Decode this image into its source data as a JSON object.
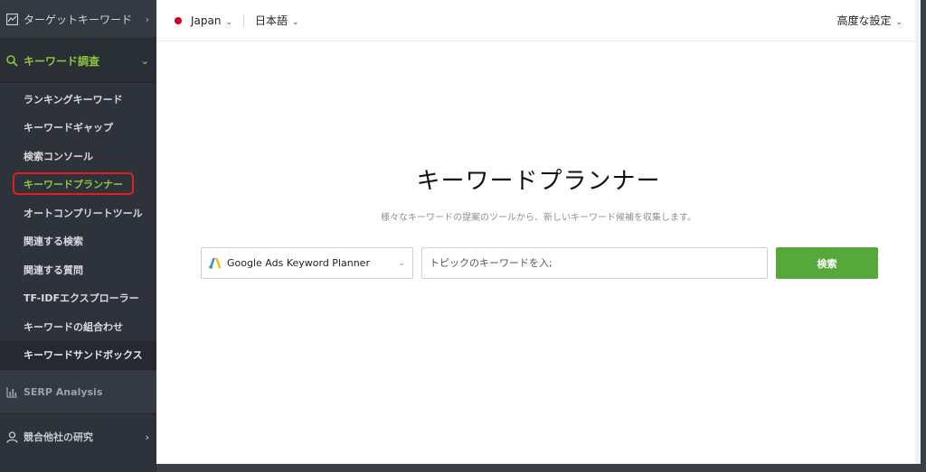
{
  "sidebar": {
    "top_item": "ターゲットキーワード",
    "section": "キーワード調査",
    "items": [
      {
        "label": "ランキングキーワード",
        "state": ""
      },
      {
        "label": "キーワードギャップ",
        "state": ""
      },
      {
        "label": "検索コンソール",
        "state": ""
      },
      {
        "label": "キーワードプランナー",
        "state": "active"
      },
      {
        "label": "オートコンプリートツール",
        "state": ""
      },
      {
        "label": "関連する検索",
        "state": ""
      },
      {
        "label": "関連する質問",
        "state": ""
      },
      {
        "label": "TF-IDFエクスプローラー",
        "state": ""
      },
      {
        "label": "キーワードの組合わせ",
        "state": ""
      },
      {
        "label": "キーワードサンドボックス",
        "state": "last"
      }
    ],
    "serp": "SERP Analysis",
    "competitor": "競合他社の研究"
  },
  "topbar": {
    "country": "Japan",
    "language": "日本語",
    "advanced": "高度な設定"
  },
  "main": {
    "title": "キーワードプランナー",
    "subtitle": "様々なキーワードの提案のツールから、新しいキーワード候補を収集します。",
    "source_select": "Google Ads Keyword Planner",
    "input_placeholder": "トピックのキーワードを入;",
    "search_button": "検索"
  },
  "colors": {
    "accent_green": "#8cc63f",
    "button_green": "#57a83b",
    "highlight_red": "#e02020"
  }
}
